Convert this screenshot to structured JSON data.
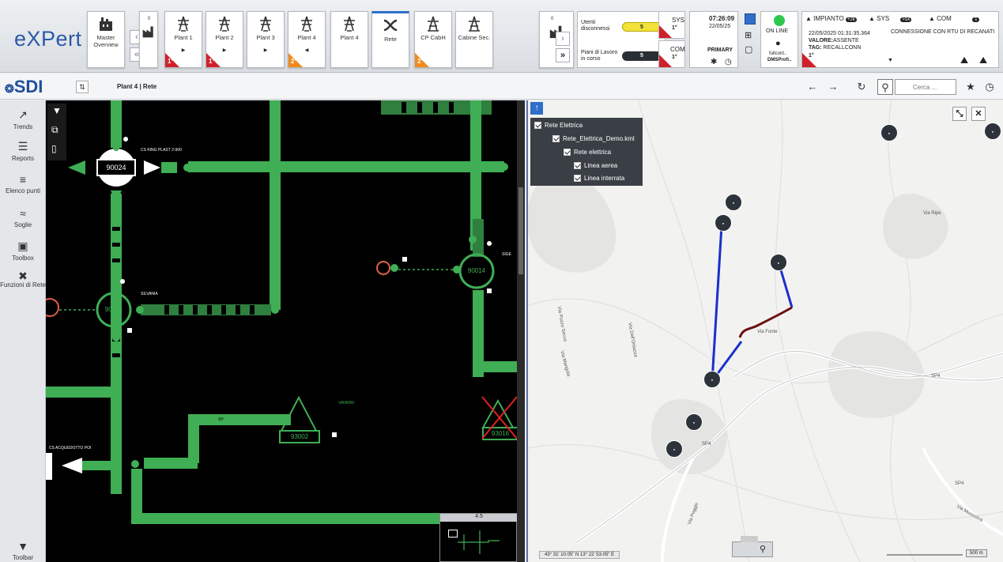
{
  "app": {
    "logo": "eXPert",
    "brand": "SDI"
  },
  "tiles": [
    {
      "label": "Master Overview",
      "icon": "plant-icon",
      "arrow": "",
      "badge": "",
      "badge_color": ""
    },
    {
      "label": "Plant 1",
      "icon": "pylon-icon",
      "arrow": "▶",
      "badge": "1°",
      "badge_color": "#d0202a",
      "count": "0"
    },
    {
      "label": "Plant 2",
      "icon": "pylon-icon",
      "arrow": "▶",
      "badge": "1°",
      "badge_color": "#d0202a"
    },
    {
      "label": "Plant 3",
      "icon": "pylon-icon",
      "arrow": "▶",
      "badge": "",
      "badge_color": ""
    },
    {
      "label": "Plant 4",
      "icon": "pylon-icon",
      "arrow": "◀",
      "badge": "2°",
      "badge_color": "#f08a1c"
    },
    {
      "label": "Plant 4",
      "icon": "pylon-icon",
      "arrow": "",
      "badge": "",
      "badge_color": ""
    },
    {
      "label": "Rete",
      "icon": "network-icon",
      "arrow": "",
      "badge": "",
      "badge_color": ""
    },
    {
      "label": "CP CabH",
      "icon": "cabin-icon",
      "arrow": "",
      "badge": "2°",
      "badge_color": "#f08a1c"
    },
    {
      "label": "Cabine Sec.",
      "icon": "cabin-icon",
      "arrow": "",
      "badge": "",
      "badge_color": ""
    }
  ],
  "users_box": {
    "label1": "Utenti disconnessi",
    "value1": "5",
    "label2": "Piani di Lavoro in corso",
    "value2": "5",
    "sys_label": "SYS",
    "sys_badge": "1°",
    "com_label": "COM",
    "com_badge": "1°"
  },
  "clock": {
    "time": "07:26:09",
    "date": "22/05/25",
    "role": "PRIMARY"
  },
  "status": {
    "online": "ON LINE",
    "user_line1": "fullcont..",
    "user_line2": "DMSProfi.."
  },
  "right_tile": {
    "count": "0"
  },
  "alarm": {
    "tab_impianto": "IMPIANTO",
    "tab_impianto_count": "+2k",
    "tab_sys": "SYS",
    "tab_sys_count": ">1k",
    "tab_com": "COM",
    "tab_com_count": "1",
    "timestamp": "22/05/2025 01:31:35.364",
    "message": "CONNESSIONE CON RTU DI RECANATI",
    "valore_label": "VALORE:",
    "valore": "ASSENTE",
    "tag_label": "TAG:",
    "tag": "RECALLCONN",
    "badge": "1°"
  },
  "breadcrumb": "Plant 4 | Rete",
  "search": {
    "placeholder": "Cerca ..."
  },
  "sidebar": [
    {
      "label": "Trends",
      "icon": "trend-icon",
      "glyph": "↗"
    },
    {
      "label": "Reports",
      "icon": "report-icon",
      "glyph": "☰"
    },
    {
      "label": "Elenco punti",
      "icon": "list-icon",
      "glyph": "≡"
    },
    {
      "label": "Soglie",
      "icon": "threshold-icon",
      "glyph": "≈"
    },
    {
      "label": "Toolbox",
      "icon": "toolbox-icon",
      "glyph": "▣"
    },
    {
      "label": "Funzioni di Rete",
      "icon": "network-functions-icon",
      "glyph": "✖"
    },
    {
      "label": "Toolbar",
      "icon": "shield-icon",
      "glyph": "▼"
    }
  ],
  "schematic": {
    "labels": {
      "king": "CS KING PLAST 2-900",
      "silvania": "SILVANIA",
      "sige": "SIGE",
      "vannini": "VANNINI",
      "acquedotto": "CS ACQUEDOTTO POI"
    },
    "nodes": {
      "n1": "90024",
      "n2": "90031",
      "n3": "90014",
      "n4": "93002",
      "n5": "93016"
    },
    "tag_sp": "SP",
    "minimap_zoom": "4.5"
  },
  "map": {
    "layers": [
      {
        "label": "Rete Elettrica"
      },
      {
        "label": "Rete_Elettrica_Demo.kml"
      },
      {
        "label": "Rete elettrica"
      },
      {
        "label": "Linea aerea"
      },
      {
        "label": "Linea interrata"
      }
    ],
    "road_labels": [
      "SP4",
      "SP4",
      "SP4",
      "Via Pozzo Secco",
      "Via Fonte",
      "Via Ripe",
      "Via Marigola",
      "Via Mussolina",
      "Via Dell'Ontazza",
      "Via Poggio"
    ],
    "coords": "43° 31' 10.05\" N 13° 22' 53.05\" E",
    "scale": "500 m"
  }
}
